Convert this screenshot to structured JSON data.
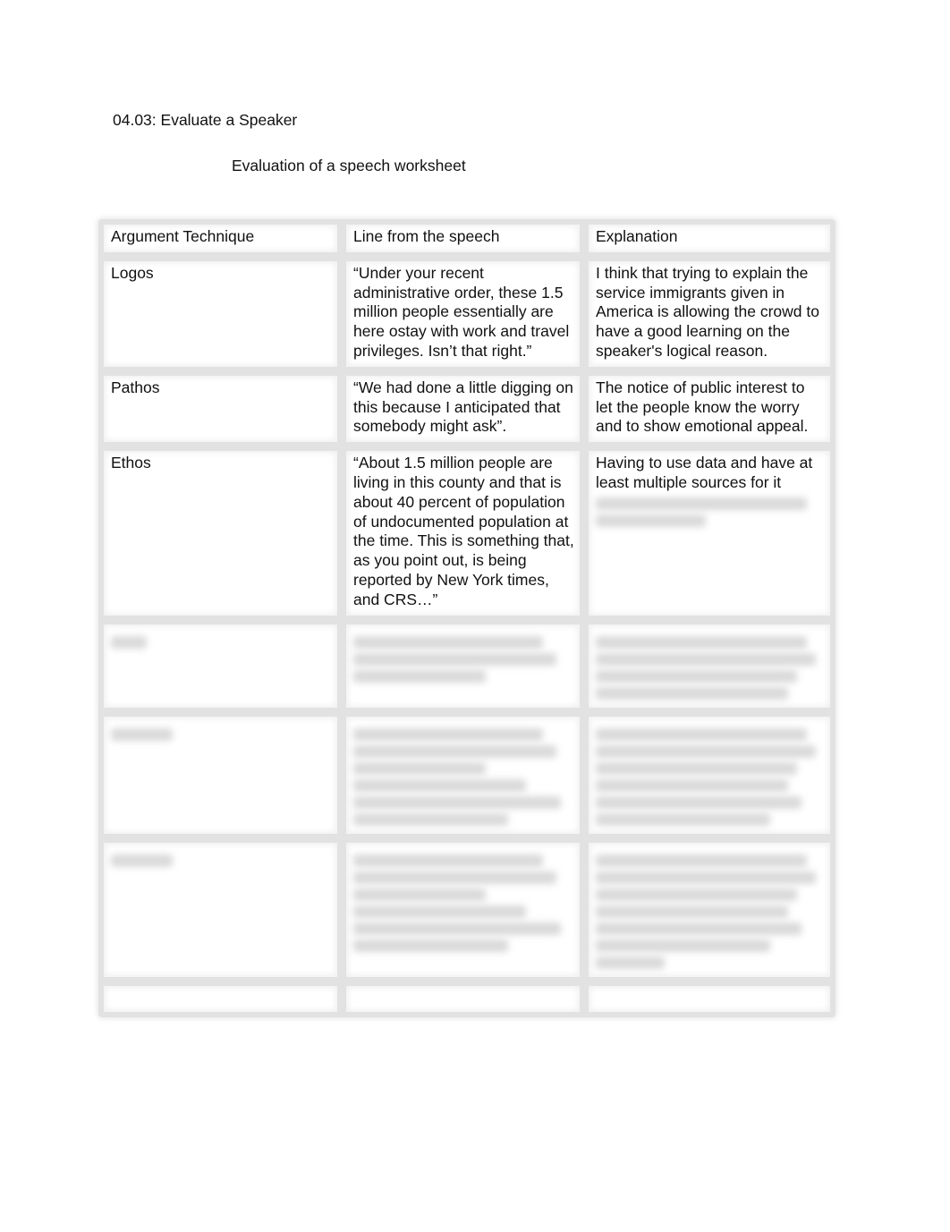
{
  "document": {
    "title": "04.03: Evaluate a Speaker",
    "subtitle": "Evaluation of a speech worksheet"
  },
  "table": {
    "headers": [
      "Argument Technique",
      "Line from the speech",
      "Explanation"
    ],
    "rows": [
      {
        "technique": "Logos",
        "line": "“Under your recent administrative order, these 1.5 million people essentially are here ostay with work and travel privileges. Isn’t that right.”",
        "explanation": "I think that trying to explain the service immigrants given in America is allowing the crowd to have a good learning on the speaker's logical reason."
      },
      {
        "technique": "Pathos",
        "line": "“We had done a little digging on this because I anticipated that somebody might ask”.",
        "explanation": "The notice of public interest to let the people know the worry and to show emotional appeal."
      },
      {
        "technique": "Ethos",
        "line": "“About 1.5 million people are living in this county and that is about 40 percent of population of undocumented population at the time. This is something that, as you point out, is being reported by New York times, and CRS…”",
        "explanation": "Having to use data and have at least multiple sources for it",
        "explanation_blurred_lines": 2
      }
    ],
    "blurred_rows": [
      {
        "technique_lines": 1,
        "line_lines": 3,
        "explanation_lines": 4
      },
      {
        "technique_lines": 1,
        "line_lines": 6,
        "explanation_lines": 6
      },
      {
        "technique_lines": 1,
        "line_lines": 6,
        "explanation_lines": 7
      }
    ],
    "empty_rows": 1
  }
}
